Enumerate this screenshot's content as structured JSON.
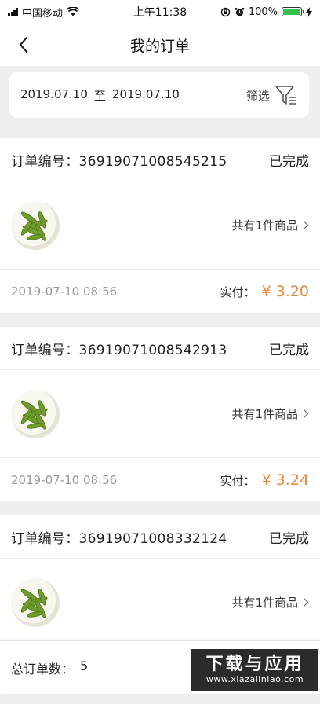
{
  "status_bar": {
    "carrier": "中国移动",
    "time": "上午11:38",
    "battery_percent": "100%"
  },
  "nav": {
    "title": "我的订单"
  },
  "filter": {
    "start_date": "2019.07.10",
    "to_label": "至",
    "end_date": "2019.07.10",
    "filter_label": "筛选"
  },
  "orders": [
    {
      "number_label": "订单编号：",
      "number": "36919071008545215",
      "status": "已完成",
      "item_count": "共有1件商品",
      "time": "2019-07-10 08:56",
      "paid_label": "实付：",
      "amount": "¥ 3.20"
    },
    {
      "number_label": "订单编号：",
      "number": "36919071008542913",
      "status": "已完成",
      "item_count": "共有1件商品",
      "time": "2019-07-10 08:56",
      "paid_label": "实付：",
      "amount": "¥ 3.24"
    },
    {
      "number_label": "订单编号：",
      "number": "36919071008332124",
      "status": "已完成",
      "item_count": "共有1件商品",
      "time": "",
      "paid_label": "",
      "amount": ""
    }
  ],
  "footer": {
    "total_label": "总订单数：",
    "total_count": "5"
  },
  "watermark": {
    "main": "下载与应用",
    "sub": "www.xiazaiinlao.com"
  },
  "colors": {
    "accent_amount": "#e8873b",
    "background": "#efeff1",
    "battery": "#35c04b"
  }
}
